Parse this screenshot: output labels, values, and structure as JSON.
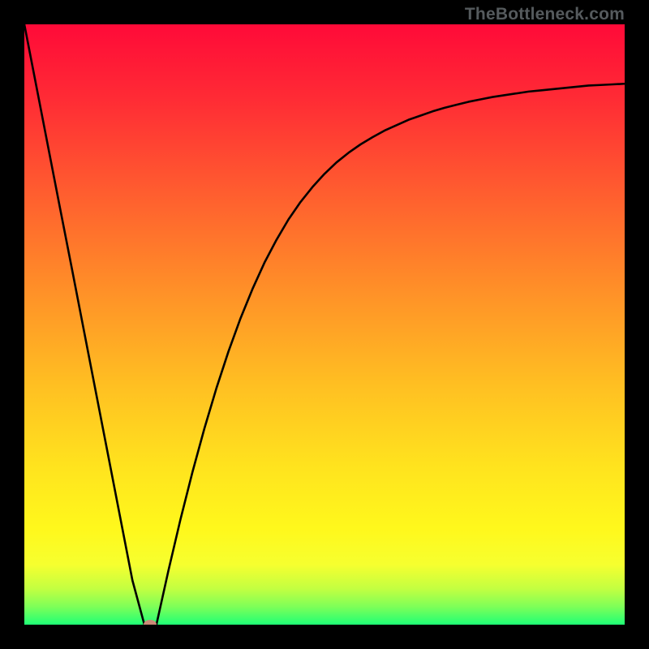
{
  "watermark": {
    "text": "TheBottleneck.com"
  },
  "colors": {
    "frame": "#000000",
    "curve": "#000000",
    "dot": "#cb8a77"
  },
  "gradient_stops": [
    {
      "pct": 0,
      "color": "#ff0a38"
    },
    {
      "pct": 12,
      "color": "#ff2a35"
    },
    {
      "pct": 28,
      "color": "#ff5d2f"
    },
    {
      "pct": 44,
      "color": "#ff8f28"
    },
    {
      "pct": 60,
      "color": "#ffbf22"
    },
    {
      "pct": 74,
      "color": "#ffe41e"
    },
    {
      "pct": 84,
      "color": "#fff81c"
    },
    {
      "pct": 90,
      "color": "#f6ff2f"
    },
    {
      "pct": 94,
      "color": "#c3ff41"
    },
    {
      "pct": 97,
      "color": "#7eff58"
    },
    {
      "pct": 100,
      "color": "#1fff76"
    }
  ],
  "chart_data": {
    "type": "line",
    "title": "",
    "xlabel": "",
    "ylabel": "",
    "xlim": [
      0,
      100
    ],
    "ylim": [
      0,
      100
    ],
    "grid": false,
    "legend": false,
    "categories": [
      0,
      2,
      4,
      6,
      8,
      10,
      12,
      14,
      16,
      18,
      20,
      22,
      24,
      26,
      28,
      30,
      32,
      34,
      36,
      38,
      40,
      42,
      44,
      46,
      48,
      50,
      52,
      54,
      56,
      58,
      60,
      62,
      64,
      66,
      68,
      70,
      72,
      74,
      76,
      78,
      80,
      82,
      84,
      86,
      88,
      90,
      92,
      94,
      96,
      98,
      100
    ],
    "series": [
      {
        "name": "bottleneck-curve",
        "values": [
          100,
          89.7,
          79.4,
          69.1,
          58.9,
          48.6,
          38.3,
          28.0,
          17.7,
          7.4,
          0.0,
          0.0,
          9.0,
          17.5,
          25.4,
          32.7,
          39.4,
          45.5,
          51.0,
          55.9,
          60.3,
          64.1,
          67.5,
          70.4,
          72.9,
          75.1,
          77.0,
          78.6,
          80.0,
          81.2,
          82.3,
          83.2,
          84.1,
          84.8,
          85.5,
          86.1,
          86.6,
          87.1,
          87.5,
          87.9,
          88.2,
          88.5,
          88.8,
          89.0,
          89.2,
          89.4,
          89.6,
          89.8,
          89.9,
          90.0,
          90.1
        ]
      }
    ],
    "annotations": [
      {
        "name": "bottleneck-point",
        "x": 21,
        "y": 0
      }
    ]
  }
}
